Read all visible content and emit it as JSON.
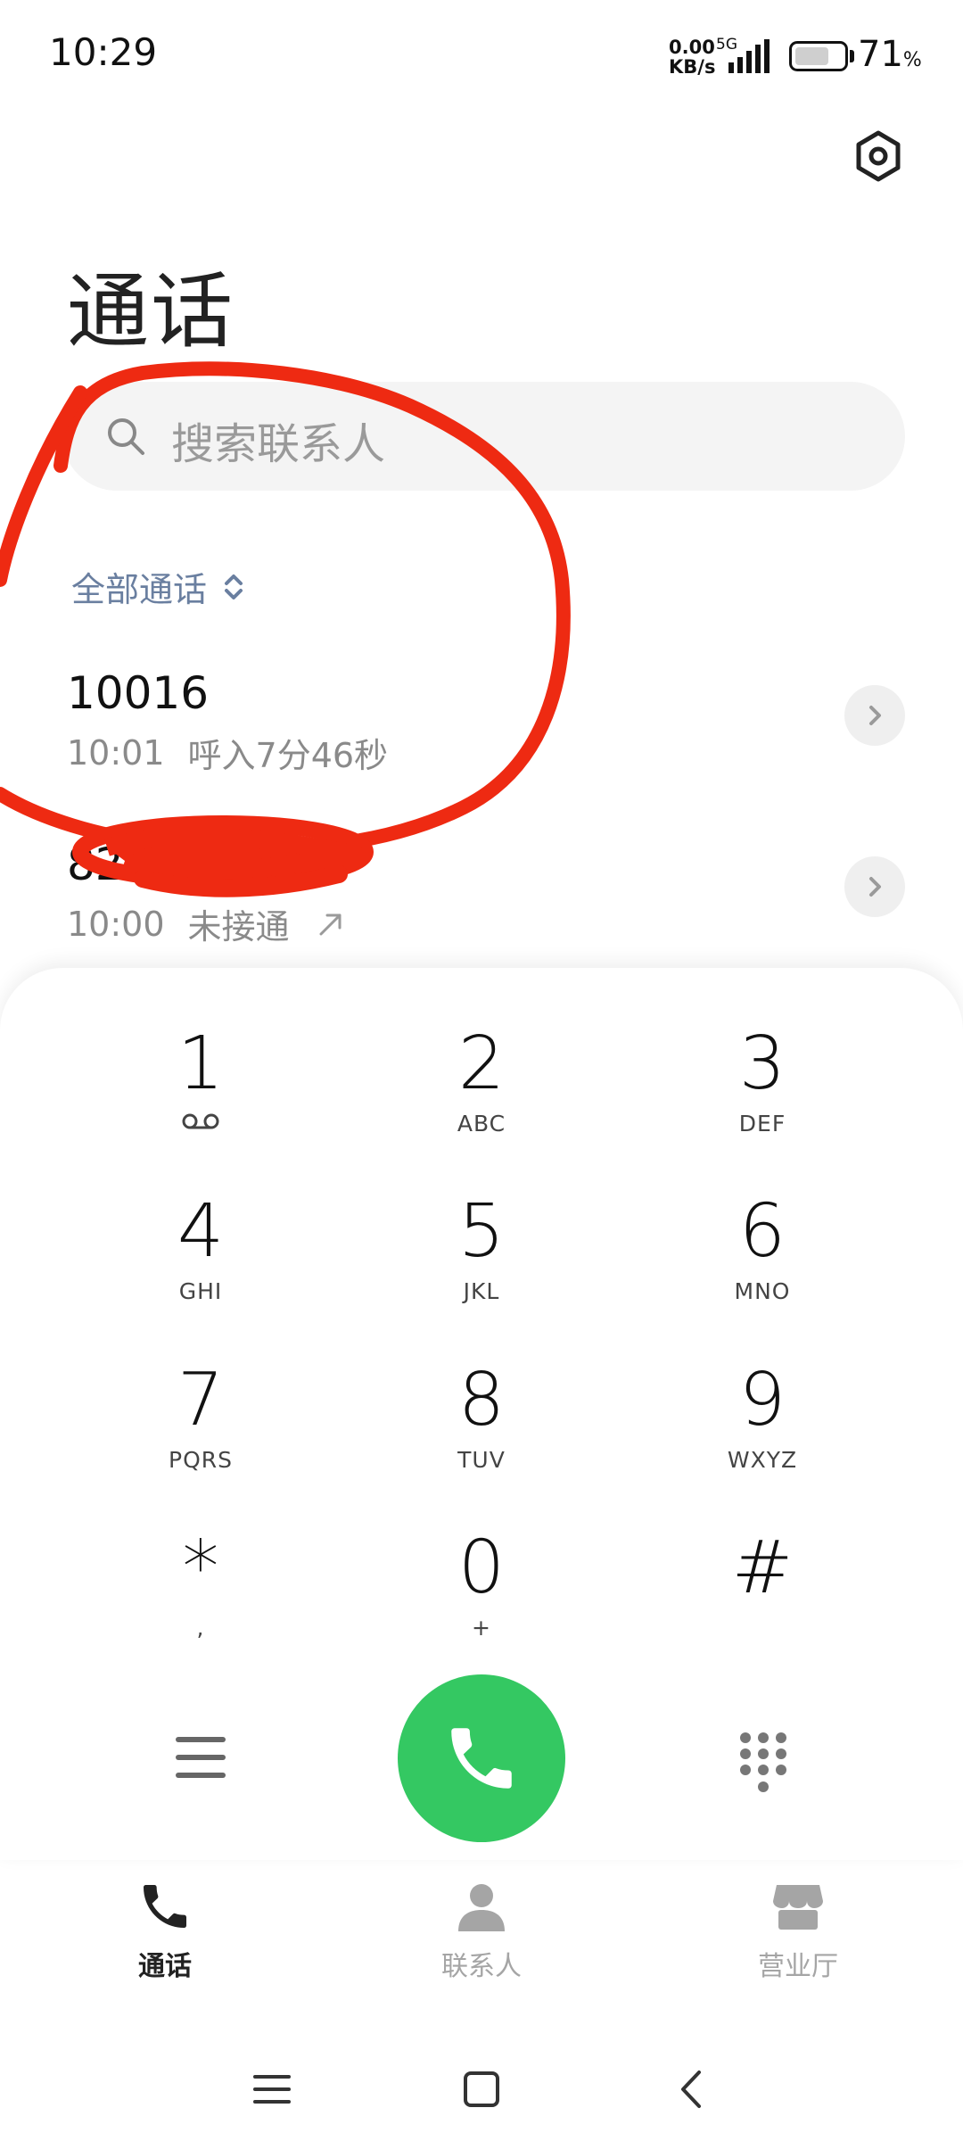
{
  "status_bar": {
    "time": "10:29",
    "net_speed_value": "0.00",
    "net_speed_unit": "KB/s",
    "network_type": "5G",
    "battery_percent": "71",
    "battery_percent_symbol": "%",
    "battery_level": 0.71,
    "icons": [
      "signal-icon",
      "battery-icon"
    ]
  },
  "header": {
    "title": "通话",
    "settings_icon": "settings-icon"
  },
  "search": {
    "placeholder": "搜索联系人"
  },
  "filter": {
    "label": "全部通话"
  },
  "calls": [
    {
      "number": "10016",
      "time": "10:01",
      "status": "呼入7分46秒"
    },
    {
      "number": "82…075",
      "time": "10:00",
      "status": "未接通",
      "direction_icon": "outgoing-arrow-icon"
    }
  ],
  "dialpad": {
    "keys": [
      {
        "digit": "1",
        "letters": ""
      },
      {
        "digit": "2",
        "letters": "ABC"
      },
      {
        "digit": "3",
        "letters": "DEF"
      },
      {
        "digit": "4",
        "letters": "GHI"
      },
      {
        "digit": "5",
        "letters": "JKL"
      },
      {
        "digit": "6",
        "letters": "MNO"
      },
      {
        "digit": "7",
        "letters": "PQRS"
      },
      {
        "digit": "8",
        "letters": "TUV"
      },
      {
        "digit": "9",
        "letters": "WXYZ"
      },
      {
        "digit": "*",
        "letters": ","
      },
      {
        "digit": "0",
        "letters": "+"
      },
      {
        "digit": "#",
        "letters": ""
      }
    ],
    "call_button_color": "#34c862"
  },
  "tabs": [
    {
      "label": "通话",
      "active": true,
      "icon": "phone-icon"
    },
    {
      "label": "联系人",
      "active": false,
      "icon": "contact-icon"
    },
    {
      "label": "营业厅",
      "active": false,
      "icon": "store-icon"
    }
  ],
  "annotation_color": "#ee2a12"
}
